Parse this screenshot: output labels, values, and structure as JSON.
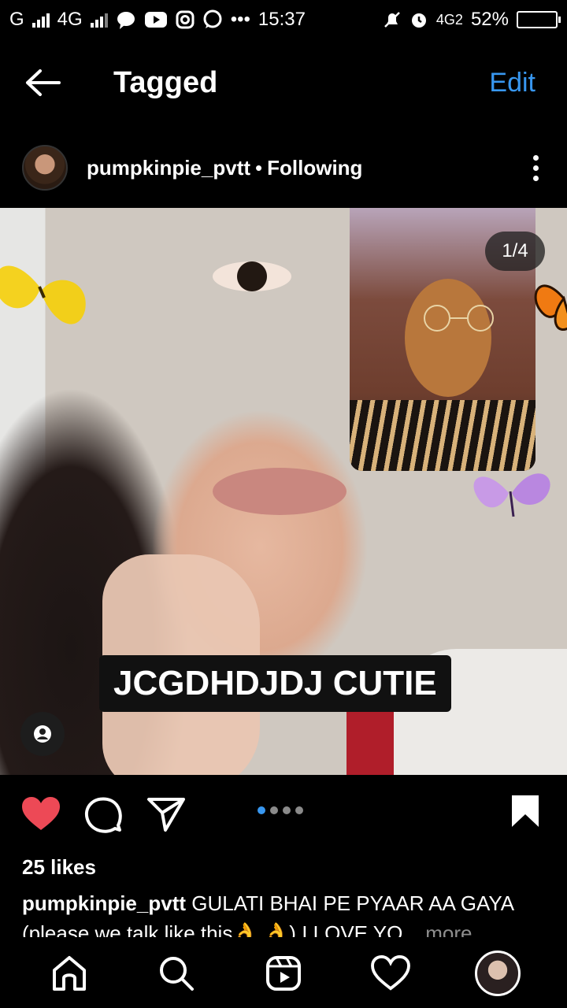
{
  "status_bar": {
    "carrier1": "G",
    "carrier2": "4G",
    "time": "15:37",
    "dots": "•••",
    "network_right": "4G2",
    "battery": "52%",
    "battery_level": 0.52,
    "battery_color": "#f5c400"
  },
  "header": {
    "title": "Tagged",
    "edit_label": "Edit",
    "accent": "#3897f0"
  },
  "post": {
    "username": "pumpkinpie_pvtt",
    "separator": "•",
    "follow_status": "Following",
    "counter": "1/4",
    "sticker_text": "JCGDHDJDJ CUTIE",
    "carousel_count": 4,
    "carousel_active": 0,
    "likes": "25 likes",
    "caption_user": "pumpkinpie_pvtt",
    "caption_text": " GULATI BHAI PE PYAAR AA GAYA (please we talk like this👌 👌) I LOVE YO",
    "caption_ellipsis": "...",
    "caption_more": " more",
    "liked": true,
    "like_color": "#ed4956"
  },
  "icons": {
    "back": "arrow-left-icon",
    "more": "three-dots-vertical-icon",
    "like": "heart-filled-icon",
    "comment": "speech-bubble-icon",
    "share": "paper-plane-icon",
    "save": "bookmark-filled-icon",
    "tag": "person-tag-icon",
    "nav": [
      "home-icon",
      "search-icon",
      "reels-icon",
      "heart-icon",
      "profile-avatar"
    ]
  }
}
